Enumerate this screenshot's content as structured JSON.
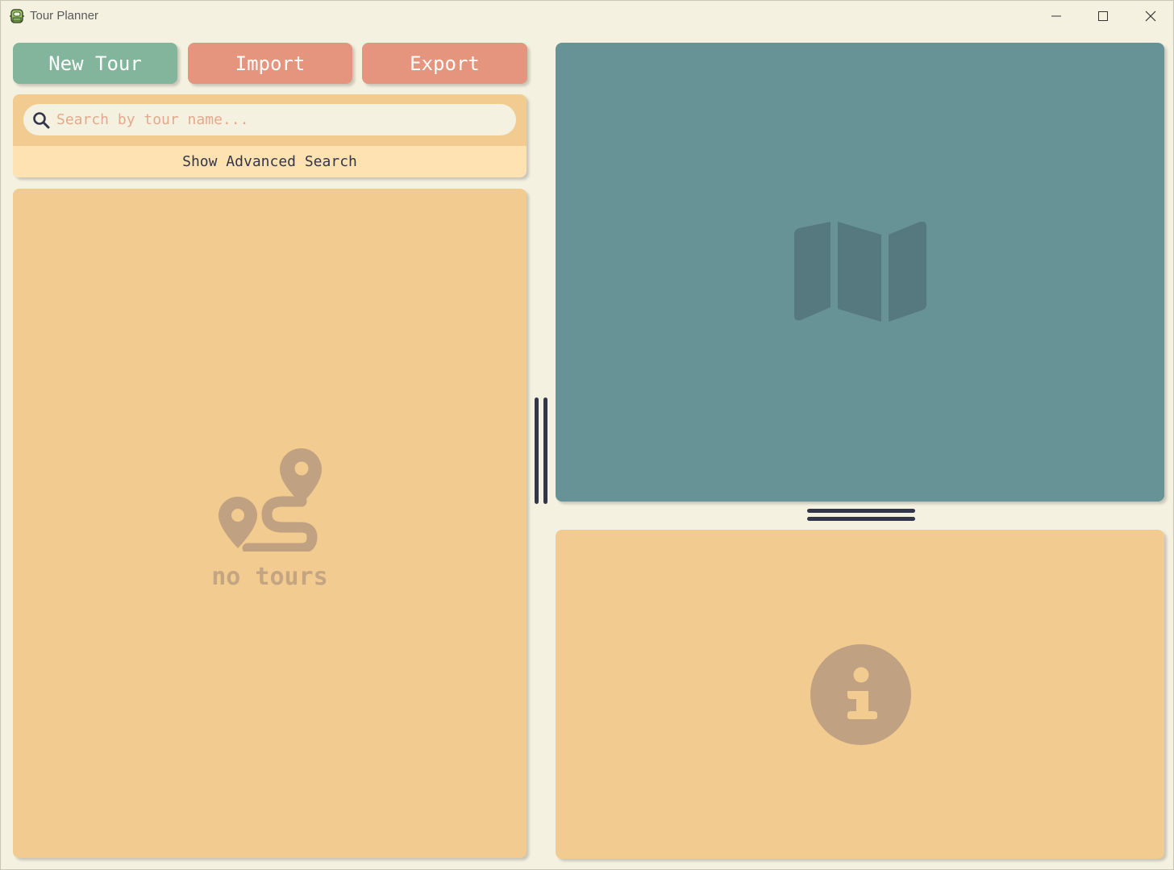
{
  "window": {
    "title": "Tour Planner",
    "controls": [
      "minimize-icon",
      "maximize-icon",
      "close-icon"
    ]
  },
  "toolbar": {
    "new_tour_label": "New Tour",
    "import_label": "Import",
    "export_label": "Export"
  },
  "search": {
    "placeholder": "Search by tour name...",
    "value": "",
    "advanced_label": "Show Advanced Search"
  },
  "tours": {
    "empty_label": "no tours",
    "empty_icon": "route-icon"
  },
  "map": {
    "placeholder_icon": "map-icon"
  },
  "details": {
    "placeholder_icon": "info-icon"
  },
  "colors": {
    "background": "#f4f1e1",
    "panel": "#f1cb8f",
    "accent_green": "#82b59b",
    "accent_salmon": "#e5947d",
    "map_teal": "#679396",
    "muted_icon": "#c0a282",
    "splitter": "#33364a"
  }
}
